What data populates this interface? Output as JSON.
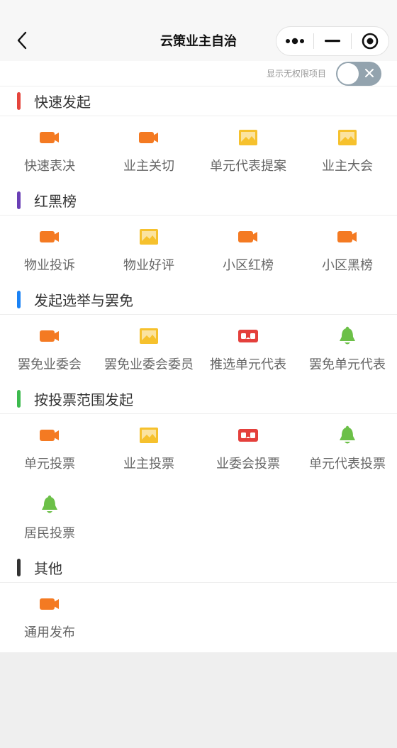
{
  "nav": {
    "title": "云策业主自治"
  },
  "toggle": {
    "label": "显示无权限项目",
    "on": false
  },
  "colors": {
    "orange": "#f47a22",
    "yellow": "#f6c12d",
    "red": "#e4403c",
    "green": "#6cc048",
    "bar_red": "#e5453d",
    "bar_purple": "#6a3fb5",
    "bar_blue": "#1a82f5",
    "bar_green": "#3dba4e",
    "bar_black": "#333333"
  },
  "sections": [
    {
      "title": "快速发起",
      "bar_color": "#e5453d",
      "items": [
        {
          "label": "快速表决",
          "icon": "video-camera-icon"
        },
        {
          "label": "业主关切",
          "icon": "video-camera-icon"
        },
        {
          "label": "单元代表提案",
          "icon": "picture-icon"
        },
        {
          "label": "业主大会",
          "icon": "picture-icon"
        }
      ]
    },
    {
      "title": "红黑榜",
      "bar_color": "#6a3fb5",
      "items": [
        {
          "label": "物业投诉",
          "icon": "video-camera-icon"
        },
        {
          "label": "物业好评",
          "icon": "picture-icon"
        },
        {
          "label": "小区红榜",
          "icon": "video-camera-icon"
        },
        {
          "label": "小区黑榜",
          "icon": "video-camera-icon"
        }
      ]
    },
    {
      "title": "发起选举与罢免",
      "bar_color": "#1a82f5",
      "items": [
        {
          "label": "罢免业委会",
          "icon": "video-camera-icon"
        },
        {
          "label": "罢免业委会委员",
          "icon": "picture-icon"
        },
        {
          "label": "推选单元代表",
          "icon": "vr-glasses-icon"
        },
        {
          "label": "罢免单元代表",
          "icon": "bell-icon"
        }
      ]
    },
    {
      "title": "按投票范围发起",
      "bar_color": "#3dba4e",
      "items": [
        {
          "label": "单元投票",
          "icon": "video-camera-icon"
        },
        {
          "label": "业主投票",
          "icon": "picture-icon"
        },
        {
          "label": "业委会投票",
          "icon": "vr-glasses-icon"
        },
        {
          "label": "单元代表投票",
          "icon": "bell-icon"
        },
        {
          "label": "居民投票",
          "icon": "bell-icon"
        }
      ]
    },
    {
      "title": "其他",
      "bar_color": "#333333",
      "items": [
        {
          "label": "通用发布",
          "icon": "video-camera-icon"
        }
      ]
    }
  ]
}
